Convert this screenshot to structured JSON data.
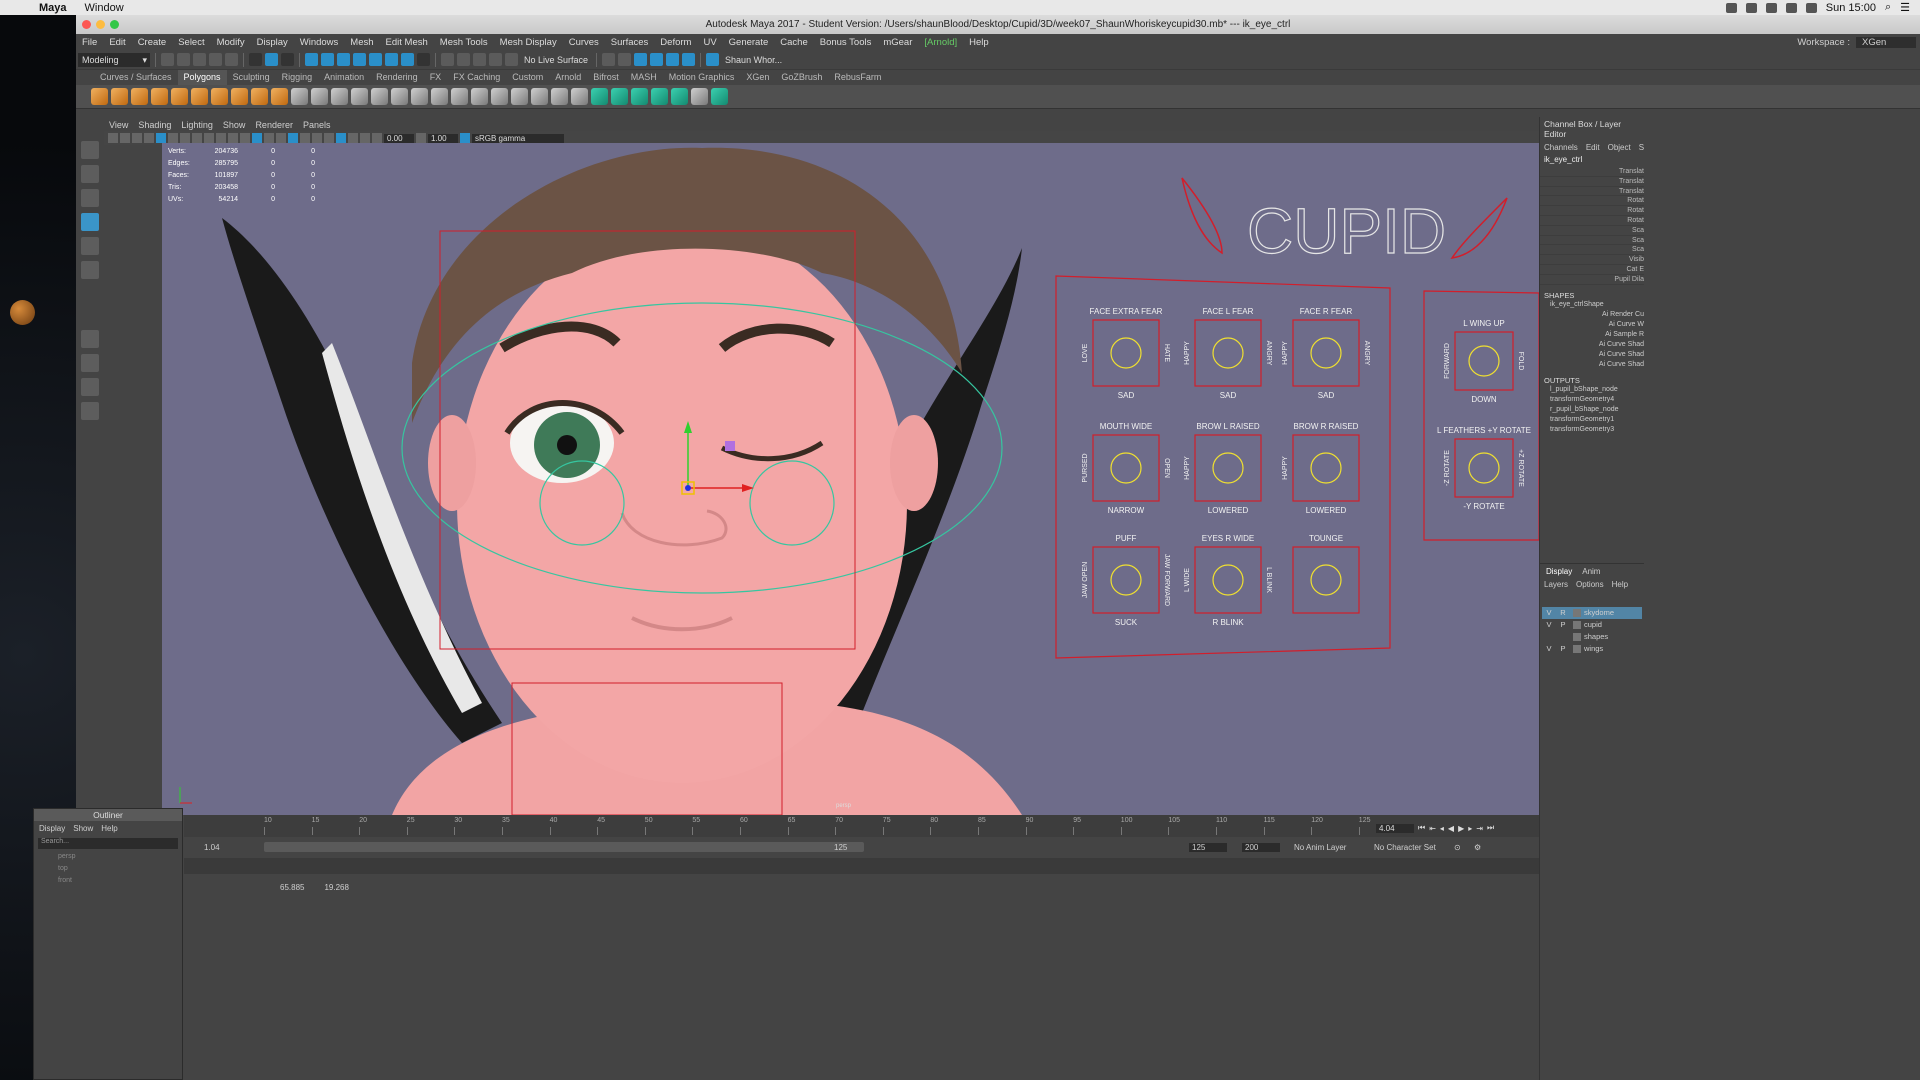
{
  "mac_menubar": {
    "app": "Maya",
    "items": [
      "Window"
    ],
    "clock": "Sun 15:00"
  },
  "titlebar": {
    "title": "Autodesk Maya 2017 - Student Version: /Users/shaunBlood/Desktop/Cupid/3D/week07_ShaunWhoriskeycupid30.mb*  ---  ik_eye_ctrl"
  },
  "main_menu": [
    "File",
    "Edit",
    "Create",
    "Select",
    "Modify",
    "Display",
    "Windows",
    "Mesh",
    "Edit Mesh",
    "Mesh Tools",
    "Mesh Display",
    "Curves",
    "Surfaces",
    "Deform",
    "UV",
    "Generate",
    "Cache",
    "Bonus Tools",
    "mGear",
    "[Arnold]",
    "Help"
  ],
  "workspace": {
    "label": "Workspace :",
    "value": "XGen"
  },
  "status_line": {
    "mode": "Modeling",
    "live_surface": "No Live Surface",
    "user": "Shaun Whor..."
  },
  "shelf_tabs": [
    "Curves / Surfaces",
    "Polygons",
    "Sculpting",
    "Rigging",
    "Animation",
    "Rendering",
    "FX",
    "FX Caching",
    "Custom",
    "Arnold",
    "Bifrost",
    "MASH",
    "Motion Graphics",
    "XGen",
    "GoZBrush",
    "RebusFarm"
  ],
  "shelf_active": "Polygons",
  "panel_menu": [
    "View",
    "Shading",
    "Lighting",
    "Show",
    "Renderer",
    "Panels"
  ],
  "panel_toolbar": {
    "exposure": "0.00",
    "gamma": "1.00",
    "color_space": "sRGB gamma"
  },
  "hud": [
    {
      "label": "Verts:",
      "v1": "204736",
      "v2": "0",
      "v3": "0"
    },
    {
      "label": "Edges:",
      "v1": "285795",
      "v2": "0",
      "v3": "0"
    },
    {
      "label": "Faces:",
      "v1": "101897",
      "v2": "0",
      "v3": "0"
    },
    {
      "label": "Tris:",
      "v1": "203458",
      "v2": "0",
      "v3": "0"
    },
    {
      "label": "UVs:",
      "v1": "54214",
      "v2": "0",
      "v3": "0"
    }
  ],
  "camera_label": "persp",
  "face_board": {
    "title": "CUPID",
    "cells": [
      {
        "top": "FACE EXTRA FEAR",
        "bottom": "SAD",
        "left": "LOVE",
        "right": "HATE"
      },
      {
        "top": "FACE L FEAR",
        "bottom": "SAD",
        "left": "HAPPY",
        "right": "ANGRY"
      },
      {
        "top": "FACE R FEAR",
        "bottom": "SAD",
        "left": "HAPPY",
        "right": "ANGRY"
      },
      {
        "top": "MOUTH WIDE",
        "bottom": "NARROW",
        "left": "PURSED",
        "right": "OPEN"
      },
      {
        "top": "BROW L RAISED",
        "bottom": "LOWERED",
        "left": "HAPPY",
        "right": ""
      },
      {
        "top": "BROW R RAISED",
        "bottom": "LOWERED",
        "left": "HAPPY",
        "right": ""
      },
      {
        "top": "PUFF",
        "bottom": "SUCK",
        "left": "JAW OPEN",
        "right": "JAW FORWARD"
      },
      {
        "top": "EYES R WIDE",
        "bottom": "R BLINK",
        "left": "L WIDE",
        "right": "L BLINK"
      },
      {
        "top": "TOUNGE",
        "bottom": "",
        "left": "",
        "right": ""
      }
    ],
    "wing_cells": [
      {
        "top": "L WING UP",
        "bottom": "DOWN",
        "left": "FORWARD",
        "right": "FOLD"
      },
      {
        "top": "L FEATHERS +Y ROTATE",
        "bottom": "-Y ROTATE",
        "left": "-Z ROTATE",
        "right": "+Z ROTATE"
      }
    ]
  },
  "right_panel": {
    "title": "Channel Box / Layer Editor",
    "menu": [
      "Channels",
      "Edit",
      "Object",
      "S"
    ],
    "object": "ik_eye_ctrl",
    "attributes": [
      "Translat",
      "Translat",
      "Translat",
      "Rotat",
      "Rotat",
      "Rotat",
      "Sca",
      "Sca",
      "Sca",
      "Visib",
      "Cat E",
      "Pupil Dila"
    ],
    "shapes_header": "SHAPES",
    "shape_name": "ik_eye_ctrlShape",
    "shape_attrs": [
      "Ai Render Cu",
      "Ai Curve W",
      "Ai Sample R",
      "Ai Curve Shad",
      "Ai Curve Shad",
      "Ai Curve Shad"
    ],
    "outputs_header": "OUTPUTS",
    "outputs": [
      "l_pupil_bShape_node",
      "transformGeometry4",
      "r_pupil_bShape_node",
      "transformGeometry1",
      "transformGeometry3"
    ],
    "layer_tabs": [
      "Display",
      "Anim"
    ],
    "layer_menu": [
      "Layers",
      "Options",
      "Help"
    ],
    "layers": [
      {
        "v": "V",
        "p": "R",
        "name": "skydome",
        "selected": true
      },
      {
        "v": "V",
        "p": "P",
        "name": "cupid",
        "selected": false
      },
      {
        "v": "",
        "p": "",
        "name": "shapes",
        "selected": false
      },
      {
        "v": "V",
        "p": "P",
        "name": "wings",
        "selected": false
      }
    ]
  },
  "timeline": {
    "ticks": [
      "10",
      "15",
      "20",
      "25",
      "30",
      "35",
      "40",
      "45",
      "50",
      "55",
      "60",
      "65",
      "70",
      "75",
      "80",
      "85",
      "90",
      "95",
      "100",
      "105",
      "110",
      "115",
      "120",
      "125"
    ],
    "current": "4.04",
    "range_start": "1.04",
    "range_end": "125",
    "end_a": "125",
    "end_b": "200",
    "anim_layer": "No Anim Layer",
    "char_set": "No Character Set"
  },
  "help_line": {
    "x": "65.885",
    "y": "19.268"
  },
  "outliner": {
    "title": "Outliner",
    "menu": [
      "Display",
      "Show",
      "Help"
    ],
    "search": "Search...",
    "items": [
      "persp",
      "top",
      "front"
    ]
  },
  "colors": {
    "viewport_bg": "#6e6c8a",
    "skin": "#f0a0a0",
    "board_red": "#d21e2b",
    "selection_blue": "#5285a6"
  }
}
